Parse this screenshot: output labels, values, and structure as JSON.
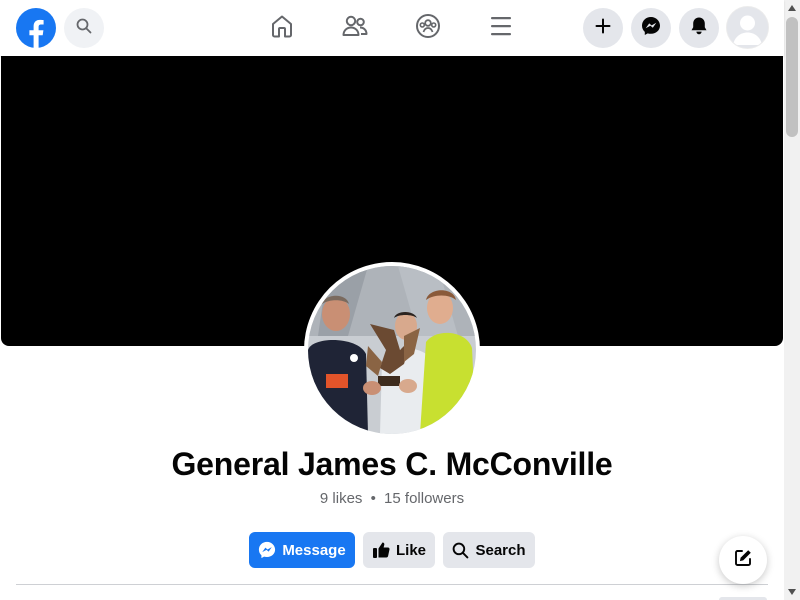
{
  "nav": {
    "logo_icon": "facebook-logo-icon",
    "search_icon": "search-icon",
    "tabs": [
      {
        "name": "home",
        "icon": "home-icon"
      },
      {
        "name": "friends",
        "icon": "friends-icon"
      },
      {
        "name": "groups",
        "icon": "groups-icon"
      },
      {
        "name": "menu",
        "icon": "menu-icon"
      }
    ],
    "right_buttons": [
      {
        "name": "create",
        "icon": "plus-icon"
      },
      {
        "name": "messenger",
        "icon": "messenger-icon"
      },
      {
        "name": "notifications",
        "icon": "bell-icon"
      },
      {
        "name": "account",
        "icon": "avatar-icon"
      }
    ]
  },
  "page": {
    "name": "General James C. McConville",
    "likes": "9 likes",
    "separator": "•",
    "followers": "15 followers"
  },
  "actions": {
    "message_label": "Message",
    "like_label": "Like",
    "search_label": "Search"
  },
  "colors": {
    "brand_blue": "#1877f2",
    "button_gray": "#e4e6eb",
    "cover": "#000000",
    "text_secondary": "#65676b"
  },
  "floating": {
    "compose_icon": "compose-icon"
  }
}
